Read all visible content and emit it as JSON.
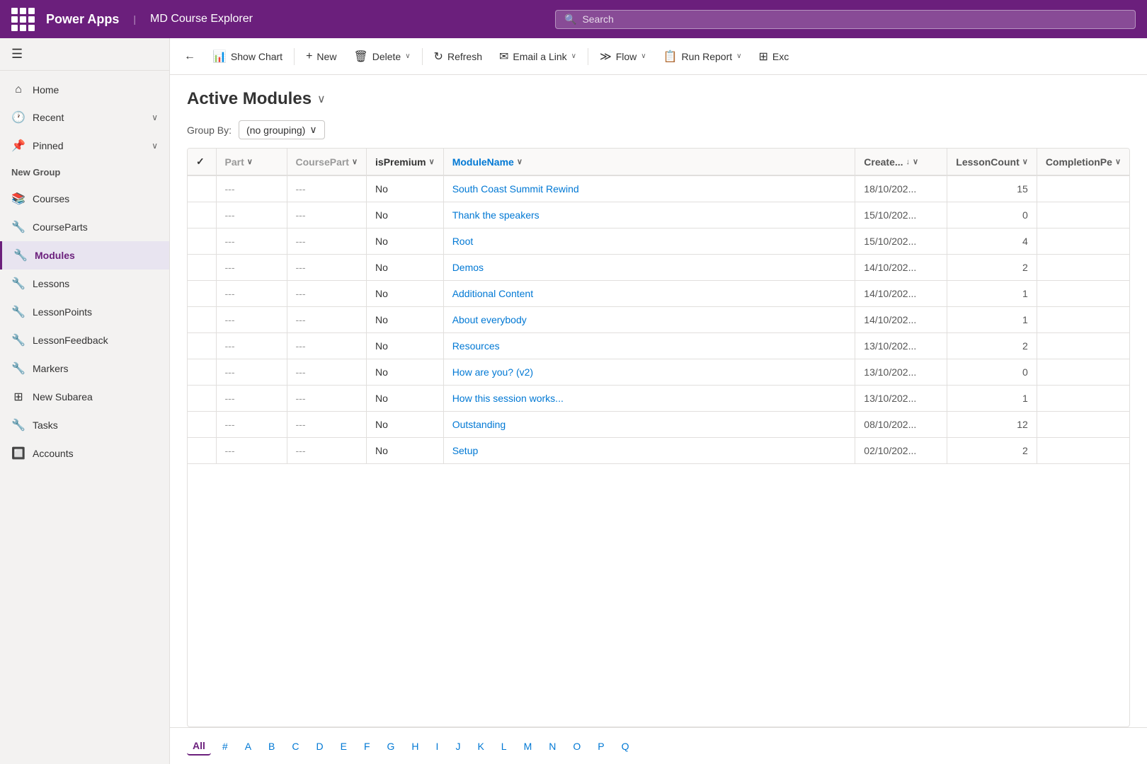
{
  "topbar": {
    "title": "Power Apps",
    "divider": "|",
    "app_name": "MD Course Explorer",
    "search_placeholder": "Search"
  },
  "sidebar": {
    "hamburger": "☰",
    "items": [
      {
        "id": "home",
        "icon": "⌂",
        "label": "Home",
        "chevron": ""
      },
      {
        "id": "recent",
        "icon": "🕐",
        "label": "Recent",
        "chevron": "∨"
      },
      {
        "id": "pinned",
        "icon": "📌",
        "label": "Pinned",
        "chevron": "∨"
      }
    ],
    "new_group_label": "New Group",
    "group_items": [
      {
        "id": "courses",
        "icon": "📚",
        "label": "Courses"
      },
      {
        "id": "courseparts",
        "icon": "🔧",
        "label": "CourseParts"
      },
      {
        "id": "modules",
        "icon": "🔧",
        "label": "Modules",
        "active": true
      },
      {
        "id": "lessons",
        "icon": "🔧",
        "label": "Lessons"
      },
      {
        "id": "lessonpoints",
        "icon": "🔧",
        "label": "LessonPoints"
      },
      {
        "id": "lessonfeedback",
        "icon": "🔧",
        "label": "LessonFeedback"
      },
      {
        "id": "markers",
        "icon": "🔧",
        "label": "Markers"
      },
      {
        "id": "newsubarea",
        "icon": "⊞",
        "label": "New Subarea"
      },
      {
        "id": "tasks",
        "icon": "🔧",
        "label": "Tasks"
      },
      {
        "id": "accounts",
        "icon": "🔲",
        "label": "Accounts"
      }
    ]
  },
  "command_bar": {
    "back_icon": "←",
    "show_chart_icon": "📊",
    "show_chart_label": "Show Chart",
    "new_icon": "+",
    "new_label": "New",
    "delete_icon": "🗑",
    "delete_label": "Delete",
    "delete_chevron": "∨",
    "refresh_icon": "↻",
    "refresh_label": "Refresh",
    "email_icon": "✉",
    "email_label": "Email a Link",
    "email_chevron": "∨",
    "flow_icon": "≫",
    "flow_label": "Flow",
    "flow_chevron": "∨",
    "report_icon": "📋",
    "report_label": "Run Report",
    "report_chevron": "∨",
    "excel_icon": "⊞",
    "excel_label": "Exc"
  },
  "view": {
    "title": "Active Modules",
    "title_chevron": "∨",
    "groupby_label": "Group By:",
    "groupby_value": "(no grouping)",
    "groupby_chevron": "∨"
  },
  "table": {
    "columns": [
      {
        "id": "check",
        "label": "✓",
        "sortable": false
      },
      {
        "id": "part",
        "label": "Part",
        "sortable": true
      },
      {
        "id": "coursepart",
        "label": "CoursePart",
        "sortable": true
      },
      {
        "id": "ispremium",
        "label": "isPremium",
        "sortable": true
      },
      {
        "id": "modulename",
        "label": "ModuleName",
        "sortable": true
      },
      {
        "id": "created",
        "label": "Create...",
        "sortable": true,
        "sort_dir": "↓"
      },
      {
        "id": "lessoncount",
        "label": "LessonCount",
        "sortable": true
      },
      {
        "id": "completionpe",
        "label": "CompletionPe",
        "sortable": true
      }
    ],
    "rows": [
      {
        "part": "---",
        "coursepart": "---",
        "ispremium": "No",
        "modulename": "South Coast Summit Rewind",
        "created": "18/10/202...",
        "lessoncount": "15",
        "completionpe": ""
      },
      {
        "part": "---",
        "coursepart": "---",
        "ispremium": "No",
        "modulename": "Thank the speakers",
        "created": "15/10/202...",
        "lessoncount": "0",
        "completionpe": ""
      },
      {
        "part": "---",
        "coursepart": "---",
        "ispremium": "No",
        "modulename": "Root",
        "created": "15/10/202...",
        "lessoncount": "4",
        "completionpe": ""
      },
      {
        "part": "---",
        "coursepart": "---",
        "ispremium": "No",
        "modulename": "Demos",
        "created": "14/10/202...",
        "lessoncount": "2",
        "completionpe": ""
      },
      {
        "part": "---",
        "coursepart": "---",
        "ispremium": "No",
        "modulename": "Additional Content",
        "created": "14/10/202...",
        "lessoncount": "1",
        "completionpe": ""
      },
      {
        "part": "---",
        "coursepart": "---",
        "ispremium": "No",
        "modulename": "About everybody",
        "created": "14/10/202...",
        "lessoncount": "1",
        "completionpe": ""
      },
      {
        "part": "---",
        "coursepart": "---",
        "ispremium": "No",
        "modulename": "Resources",
        "created": "13/10/202...",
        "lessoncount": "2",
        "completionpe": ""
      },
      {
        "part": "---",
        "coursepart": "---",
        "ispremium": "No",
        "modulename": "How are you? (v2)",
        "created": "13/10/202...",
        "lessoncount": "0",
        "completionpe": ""
      },
      {
        "part": "---",
        "coursepart": "---",
        "ispremium": "No",
        "modulename": "How this session works...",
        "created": "13/10/202...",
        "lessoncount": "1",
        "completionpe": ""
      },
      {
        "part": "---",
        "coursepart": "---",
        "ispremium": "No",
        "modulename": "Outstanding",
        "created": "08/10/202...",
        "lessoncount": "12",
        "completionpe": ""
      },
      {
        "part": "---",
        "coursepart": "---",
        "ispremium": "No",
        "modulename": "Setup",
        "created": "02/10/202...",
        "lessoncount": "2",
        "completionpe": ""
      }
    ]
  },
  "pagination": {
    "links": [
      "All",
      "#",
      "A",
      "B",
      "C",
      "D",
      "E",
      "F",
      "G",
      "H",
      "I",
      "J",
      "K",
      "L",
      "M",
      "N",
      "O",
      "P",
      "Q"
    ],
    "active": "All"
  }
}
